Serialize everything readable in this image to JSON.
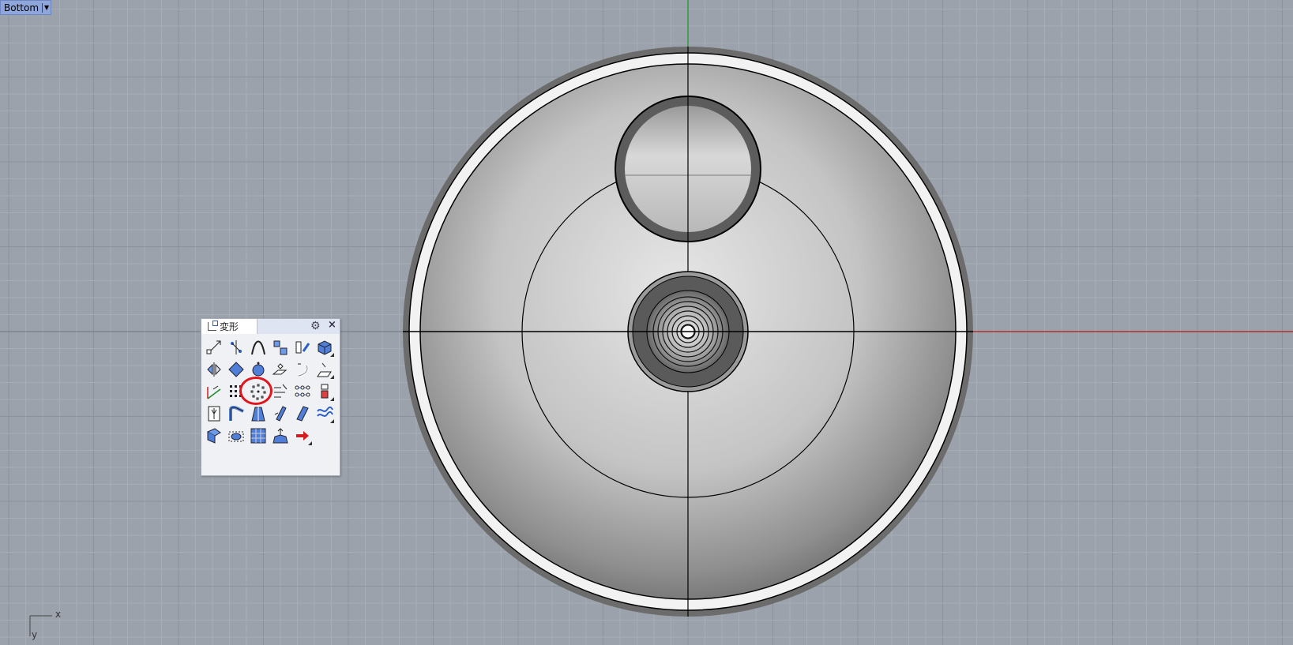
{
  "viewport": {
    "name": "Bottom",
    "axis_x": "x",
    "axis_y": "y"
  },
  "colors": {
    "background": "#9ba2ab",
    "grid_minor": "#a7adb5",
    "grid_major": "#8b929b",
    "axis_x": "#b0302b",
    "axis_y": "#2d9b3c",
    "highlight": "#e0151d"
  },
  "toolbar_panel": {
    "title": "変形",
    "buttons": [
      [
        "move-icon",
        "copy-icon",
        "drag-point-icon",
        "align-icon",
        "rotate-3d-icon",
        "box-edit-icon"
      ],
      [
        "mirror-icon",
        "rotate-icon",
        "scale-icon",
        "orient-icon",
        "bend-icon",
        "shear-icon"
      ],
      [
        "set-point-icon",
        "rectangular-array-icon",
        "polar-array-icon",
        "array-along-curve-icon",
        "array-linear-icon",
        "smash-icon"
      ],
      [
        "taper-icon",
        "flow-along-curve-icon",
        "stretch-icon",
        "twist-icon",
        "flow-along-surface-icon",
        "splop-icon"
      ],
      [
        "cage-edit-icon",
        "bounding-box-icon",
        "project-icon",
        "fit-icon",
        "next-arrow-icon"
      ]
    ],
    "highlighted_button": "polar-array-icon"
  }
}
